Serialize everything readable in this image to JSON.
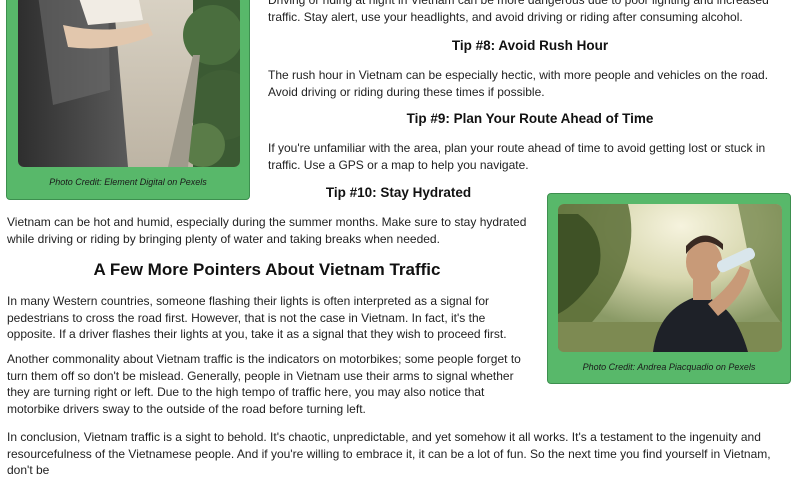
{
  "article": {
    "night_para": "Driving or riding at night in Vietnam can be more dangerous due to poor lighting and increased traffic. Stay alert, use your headlights, and avoid driving or riding after consuming alcohol.",
    "tip8_heading": "Tip #8: Avoid Rush Hour",
    "tip8_para": "The rush hour in Vietnam can be especially hectic, with more people and vehicles on the road. Avoid driving or riding during these times if possible.",
    "tip9_heading": "Tip #9: Plan Your Route Ahead of Time",
    "tip9_para": "If you're unfamiliar with the area, plan your route ahead of time to avoid getting lost or stuck in traffic. Use a GPS or a map to help you navigate.",
    "tip10_heading": "Tip #10: Stay Hydrated",
    "tip10_para": "Vietnam can be hot and humid, especially during the summer months. Make sure to stay hydrated while driving or riding by bringing plenty of water and taking breaks when needed.",
    "pointers_heading": "A Few More Pointers About Vietnam Traffic",
    "pointers_para1": "In many Western countries, someone flashing their lights is often interpreted as a signal for pedestrians to cross the road first. However, that is not the case in Vietnam. In fact, it's the opposite. If a driver flashes their lights at you, take it as a signal that they wish to proceed first.",
    "pointers_para2": "Another commonality about Vietnam traffic is the indicators on motorbikes; some people forget to turn them off so don't be mislead. Generally, people in Vietnam use their arms to signal whether they are turning right or left. Due to the high tempo of traffic here, you may also notice that motorbike drivers sway to the outside of the road before turning left.",
    "conclusion_para": "In conclusion, Vietnam traffic is a sight to behold. It's chaotic, unpredictable, and yet somehow it all works. It's a testament to the ingenuity and resourcefulness of the Vietnamese people. And if you're willing to embrace it, it can be a lot of fun. So the next time you find yourself in Vietnam, don't be"
  },
  "photos": {
    "left_credit": "Photo Credit: Element Digital on Pexels",
    "right_credit": "Photo Credit: Andrea Piacquadio on Pexels"
  },
  "colors": {
    "card_green": "#58b86a",
    "text": "#222222"
  }
}
